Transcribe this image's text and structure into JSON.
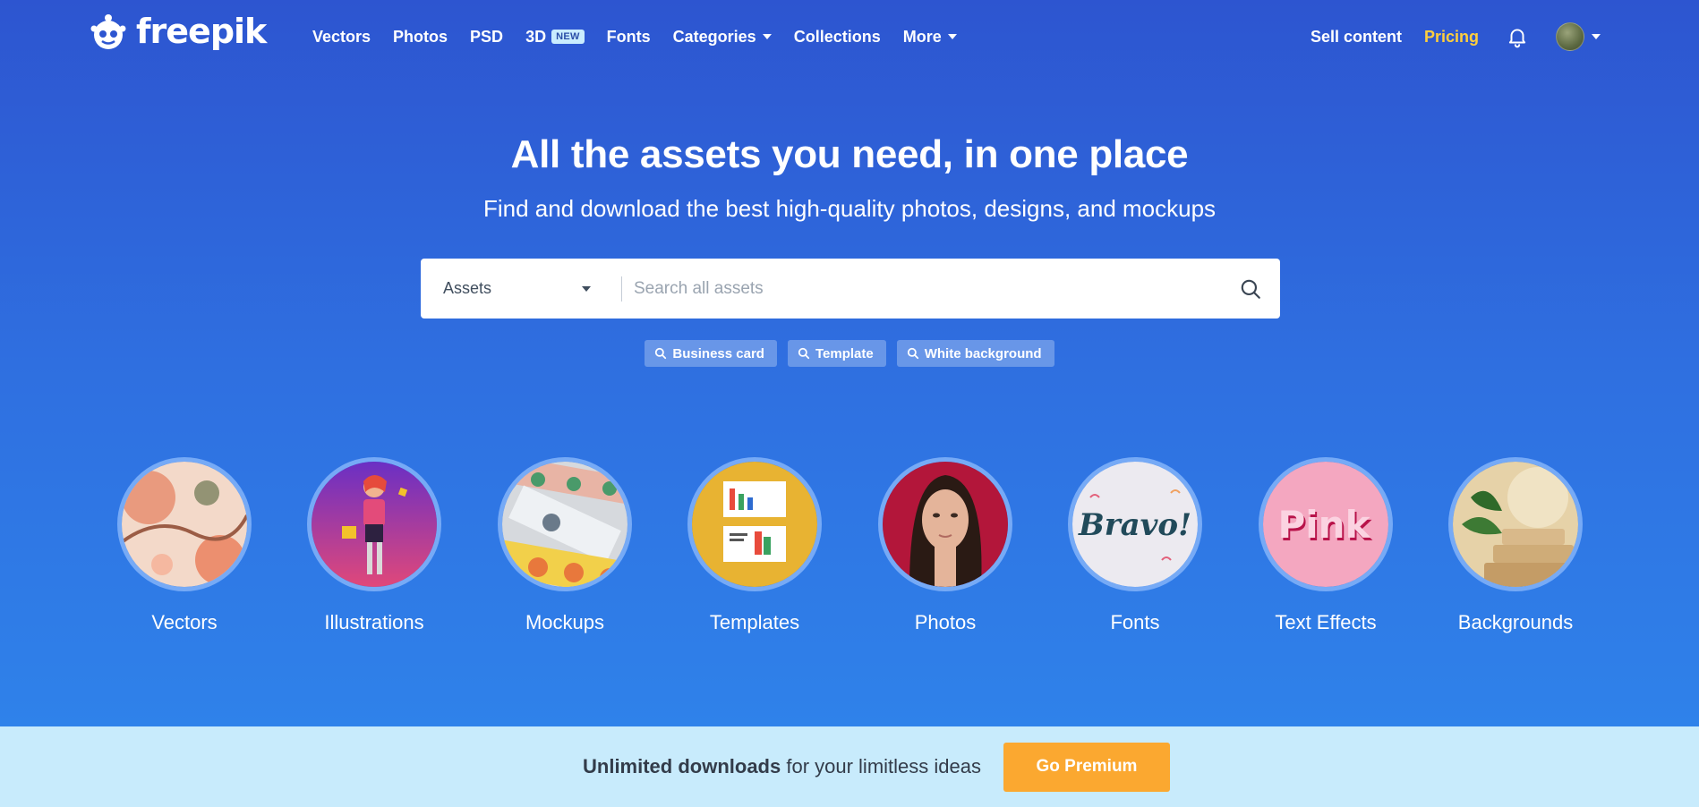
{
  "brand": {
    "name": "freepik",
    "logo_icon": "robot-mascot-icon"
  },
  "nav": {
    "links": [
      {
        "label": "Vectors"
      },
      {
        "label": "Photos"
      },
      {
        "label": "PSD"
      },
      {
        "label": "3D",
        "badge": "NEW"
      },
      {
        "label": "Fonts"
      },
      {
        "label": "Categories",
        "dropdown": true
      },
      {
        "label": "Collections"
      },
      {
        "label": "More",
        "dropdown": true
      }
    ],
    "sell_label": "Sell content",
    "pricing_label": "Pricing"
  },
  "hero": {
    "title": "All the assets you need, in one place",
    "subtitle": "Find and download the best high-quality photos, designs, and mockups"
  },
  "search": {
    "scope": "Assets",
    "placeholder": "Search all assets"
  },
  "tags": [
    "Business card",
    "Template",
    "White background"
  ],
  "categories": [
    {
      "label": "Vectors"
    },
    {
      "label": "Illustrations"
    },
    {
      "label": "Mockups"
    },
    {
      "label": "Templates"
    },
    {
      "label": "Photos"
    },
    {
      "label": "Fonts",
      "image_text": "Bravo!"
    },
    {
      "label": "Text Effects",
      "image_text": "Pink"
    },
    {
      "label": "Backgrounds"
    }
  ],
  "banner": {
    "bold": "Unlimited downloads",
    "rest": " for your limitless ideas",
    "button": "Go Premium"
  },
  "colors": {
    "accent_yellow": "#ffce3d",
    "premium_orange": "#fba830",
    "banner_bg": "#c8ebfc"
  }
}
